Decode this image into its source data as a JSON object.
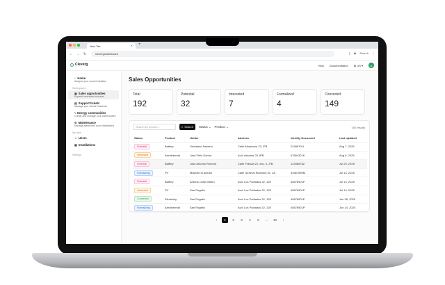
{
  "browser": {
    "tab_title": "New Tab",
    "url": "cleverg/dashboard",
    "search_label": "Search",
    "traffic_colors": [
      "#ff5f57",
      "#febc2e",
      "#28c840"
    ]
  },
  "app": {
    "brand": "Cleverg",
    "help": "Help",
    "documentation": "Documentation",
    "language": "US",
    "avatar_initial": "A"
  },
  "sidebar": {
    "home": {
      "title": "Home",
      "subtitle": "Analyze your current situation"
    },
    "workspaces_label": "Workspaces",
    "workspaces": [
      {
        "title": "Sales opportunities",
        "subtitle": "Expand contracted services",
        "icon": "briefcase-icon"
      },
      {
        "title": "Support tickets",
        "subtitle": "Manage your clients' incidents",
        "icon": "ticket-icon"
      },
      {
        "title": "Energy communities",
        "subtitle": "Create and manage your communities",
        "icon": "bolt-icon"
      },
      {
        "title": "Maintenance",
        "subtitle": "Manage alerts from your installations",
        "icon": "wrench-icon"
      }
    ],
    "my_data_label": "My data",
    "my_data": [
      {
        "title": "Users",
        "icon": "users-icon"
      },
      {
        "title": "Installations",
        "icon": "building-icon"
      }
    ],
    "settings_label": "Settings"
  },
  "main": {
    "title": "Sales Opportunities",
    "stats": [
      {
        "label": "Total",
        "value": "192"
      },
      {
        "label": "Potential",
        "value": "32"
      },
      {
        "label": "Interested",
        "value": "7"
      },
      {
        "label": "Formalized",
        "value": "4"
      },
      {
        "label": "Converted",
        "value": "149"
      }
    ],
    "search_placeholder": "Search by invoice...",
    "search_button": "Search",
    "filter_status": "Status",
    "filter_product": "Product",
    "results": "192 results",
    "columns": [
      "Status",
      "Product",
      "Holder",
      "Address",
      "Identity Document",
      "Last updated"
    ],
    "rows": [
      {
        "status": "Potential",
        "status_type": "potential",
        "product": "Battery",
        "holder": "Victoriano Navarro",
        "address": "Calle Albarracín 23, 3ºB",
        "doc": "22488791L",
        "updated": "Aug 7, 2025"
      },
      {
        "status": "Interested",
        "status_type": "interested",
        "product": "Aerothermal",
        "holder": "Jose Félix García",
        "address": "Avd. Asturias 25, 8ºB",
        "doc": "67654321K",
        "updated": "Aug 6, 2025"
      },
      {
        "status": "Potential",
        "status_type": "potential",
        "product": "Battery",
        "holder": "Jose Antonio Romero",
        "address": "Calle Francia 22, esc. 3, 2ºB",
        "doc": "12345678Z",
        "updated": "Jul 20, 2025"
      },
      {
        "status": "Formalizing",
        "status_type": "formalizing",
        "product": "PV",
        "holder": "Maestre el Acedor",
        "address": "Calle General Ricardos 51, 2A",
        "doc": "34567890M",
        "updated": "Jul 14, 2025"
      },
      {
        "status": "Potential",
        "status_type": "potential",
        "product": "Battery",
        "holder": "Antonio José Martín",
        "address": "Avd. Los Poblados 32, 12E",
        "doc": "45678901P",
        "updated": "Jul 14, 2025"
      },
      {
        "status": "Interested",
        "status_type": "interested",
        "product": "PV",
        "holder": "San Rogelio",
        "address": "Avd. Los Poblados 32, 12E",
        "doc": "45678901P",
        "updated": "Jul 14, 2025"
      },
      {
        "status": "Converted",
        "status_type": "converted",
        "product": "Electricity",
        "holder": "San Rogelio",
        "address": "Avd. Los Poblados 32, 12E",
        "doc": "45678901P",
        "updated": "Jun 28, 2025"
      },
      {
        "status": "Formalizing",
        "status_type": "formalizing",
        "product": "Aerothermal",
        "holder": "San Rogelio",
        "address": "Avd. Los Poblados 32, 12E",
        "doc": "45678901P",
        "updated": "Jun 14, 2025"
      }
    ],
    "pagination": {
      "pages": [
        "1",
        "2",
        "3",
        "4",
        "5"
      ],
      "ellipsis": "...",
      "last": "10",
      "current": "1"
    }
  },
  "colors": {
    "accent": "#2e9e6a",
    "dark_button": "#111111"
  }
}
